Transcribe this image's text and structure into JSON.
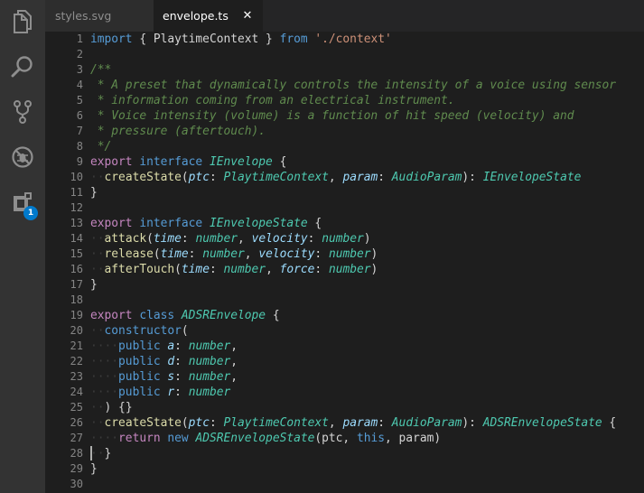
{
  "activity_bar": {
    "items": [
      {
        "name": "explorer-icon"
      },
      {
        "name": "search-icon"
      },
      {
        "name": "source-control-icon"
      },
      {
        "name": "debug-icon"
      },
      {
        "name": "extensions-icon",
        "badge": "1"
      }
    ],
    "badge_color": "#007acc"
  },
  "tabs": [
    {
      "label": "styles.svg",
      "active": false
    },
    {
      "label": "envelope.ts",
      "active": true,
      "close_glyph": "✕"
    }
  ],
  "editor": {
    "line_numbers": [
      "1",
      "2",
      "3",
      "4",
      "5",
      "6",
      "7",
      "8",
      "9",
      "10",
      "11",
      "12",
      "13",
      "14",
      "15",
      "16",
      "17",
      "18",
      "19",
      "20",
      "21",
      "22",
      "23",
      "24",
      "25",
      "26",
      "27",
      "28",
      "29",
      "30"
    ],
    "lines": [
      [
        [
          "kw",
          "import"
        ],
        [
          "pl",
          " { PlaytimeContext } "
        ],
        [
          "kw",
          "from"
        ],
        [
          "pl",
          " "
        ],
        [
          "str",
          "'./context'"
        ]
      ],
      [],
      [
        [
          "cm",
          "/**"
        ]
      ],
      [
        [
          "cm",
          " * A preset that dynamically controls the intensity of a voice using sensor"
        ]
      ],
      [
        [
          "cm",
          " * information coming from an electrical instrument."
        ]
      ],
      [
        [
          "cm",
          " * Voice intensity (volume) is a function of hit speed (velocity) and"
        ]
      ],
      [
        [
          "cm",
          " * pressure (aftertouch)."
        ]
      ],
      [
        [
          "cm",
          " */"
        ]
      ],
      [
        [
          "kwc",
          "export"
        ],
        [
          "pl",
          " "
        ],
        [
          "kw",
          "interface"
        ],
        [
          "pl",
          " "
        ],
        [
          "ty",
          "IEnvelope"
        ],
        [
          "pl",
          " {"
        ]
      ],
      [
        [
          "ws",
          "··"
        ],
        [
          "fn",
          "createState"
        ],
        [
          "pl",
          "("
        ],
        [
          "pr",
          "ptc"
        ],
        [
          "pl",
          ": "
        ],
        [
          "ty",
          "PlaytimeContext"
        ],
        [
          "pl",
          ", "
        ],
        [
          "pr",
          "param"
        ],
        [
          "pl",
          ": "
        ],
        [
          "ty",
          "AudioParam"
        ],
        [
          "pl",
          "): "
        ],
        [
          "ty",
          "IEnvelopeState"
        ]
      ],
      [
        [
          "pl",
          "}"
        ]
      ],
      [],
      [
        [
          "kwc",
          "export"
        ],
        [
          "pl",
          " "
        ],
        [
          "kw",
          "interface"
        ],
        [
          "pl",
          " "
        ],
        [
          "ty",
          "IEnvelopeState"
        ],
        [
          "pl",
          " {"
        ]
      ],
      [
        [
          "ws",
          "··"
        ],
        [
          "fn",
          "attack"
        ],
        [
          "pl",
          "("
        ],
        [
          "pr",
          "time"
        ],
        [
          "pl",
          ": "
        ],
        [
          "ty",
          "number"
        ],
        [
          "pl",
          ", "
        ],
        [
          "pr",
          "velocity"
        ],
        [
          "pl",
          ": "
        ],
        [
          "ty",
          "number"
        ],
        [
          "pl",
          ")"
        ]
      ],
      [
        [
          "ws",
          "··"
        ],
        [
          "fn",
          "release"
        ],
        [
          "pl",
          "("
        ],
        [
          "pr",
          "time"
        ],
        [
          "pl",
          ": "
        ],
        [
          "ty",
          "number"
        ],
        [
          "pl",
          ", "
        ],
        [
          "pr",
          "velocity"
        ],
        [
          "pl",
          ": "
        ],
        [
          "ty",
          "number"
        ],
        [
          "pl",
          ")"
        ]
      ],
      [
        [
          "ws",
          "··"
        ],
        [
          "fn",
          "afterTouch"
        ],
        [
          "pl",
          "("
        ],
        [
          "pr",
          "time"
        ],
        [
          "pl",
          ": "
        ],
        [
          "ty",
          "number"
        ],
        [
          "pl",
          ", "
        ],
        [
          "pr",
          "force"
        ],
        [
          "pl",
          ": "
        ],
        [
          "ty",
          "number"
        ],
        [
          "pl",
          ")"
        ]
      ],
      [
        [
          "pl",
          "}"
        ]
      ],
      [],
      [
        [
          "kwc",
          "export"
        ],
        [
          "pl",
          " "
        ],
        [
          "kw",
          "class"
        ],
        [
          "pl",
          " "
        ],
        [
          "ty",
          "ADSREnvelope"
        ],
        [
          "pl",
          " {"
        ]
      ],
      [
        [
          "ws",
          "··"
        ],
        [
          "kw",
          "constructor"
        ],
        [
          "pl",
          "("
        ]
      ],
      [
        [
          "ws",
          "····"
        ],
        [
          "kw",
          "public"
        ],
        [
          "pl",
          " "
        ],
        [
          "pr",
          "a"
        ],
        [
          "pl",
          ": "
        ],
        [
          "ty",
          "number"
        ],
        [
          "pl",
          ","
        ]
      ],
      [
        [
          "ws",
          "····"
        ],
        [
          "kw",
          "public"
        ],
        [
          "pl",
          " "
        ],
        [
          "pr",
          "d"
        ],
        [
          "pl",
          ": "
        ],
        [
          "ty",
          "number"
        ],
        [
          "pl",
          ","
        ]
      ],
      [
        [
          "ws",
          "····"
        ],
        [
          "kw",
          "public"
        ],
        [
          "pl",
          " "
        ],
        [
          "pr",
          "s"
        ],
        [
          "pl",
          ": "
        ],
        [
          "ty",
          "number"
        ],
        [
          "pl",
          ","
        ]
      ],
      [
        [
          "ws",
          "····"
        ],
        [
          "kw",
          "public"
        ],
        [
          "pl",
          " "
        ],
        [
          "pr",
          "r"
        ],
        [
          "pl",
          ": "
        ],
        [
          "ty",
          "number"
        ]
      ],
      [
        [
          "ws",
          "··"
        ],
        [
          "pl",
          ") {}"
        ]
      ],
      [
        [
          "ws",
          "··"
        ],
        [
          "fn",
          "createState"
        ],
        [
          "pl",
          "("
        ],
        [
          "pr",
          "ptc"
        ],
        [
          "pl",
          ": "
        ],
        [
          "ty",
          "PlaytimeContext"
        ],
        [
          "pl",
          ", "
        ],
        [
          "pr",
          "param"
        ],
        [
          "pl",
          ": "
        ],
        [
          "ty",
          "AudioParam"
        ],
        [
          "pl",
          "): "
        ],
        [
          "ty",
          "ADSREnvelopeState"
        ],
        [
          "pl",
          " {"
        ]
      ],
      [
        [
          "ws",
          "····"
        ],
        [
          "kwc",
          "return"
        ],
        [
          "pl",
          " "
        ],
        [
          "kw",
          "new"
        ],
        [
          "pl",
          " "
        ],
        [
          "ty",
          "ADSREnvelopeState"
        ],
        [
          "pl",
          "(ptc, "
        ],
        [
          "kw",
          "this"
        ],
        [
          "pl",
          ", param)"
        ]
      ],
      [
        [
          "cursor",
          ""
        ],
        [
          "ws",
          "··"
        ],
        [
          "pl",
          "}"
        ]
      ],
      [
        [
          "pl",
          "}"
        ]
      ],
      []
    ]
  }
}
